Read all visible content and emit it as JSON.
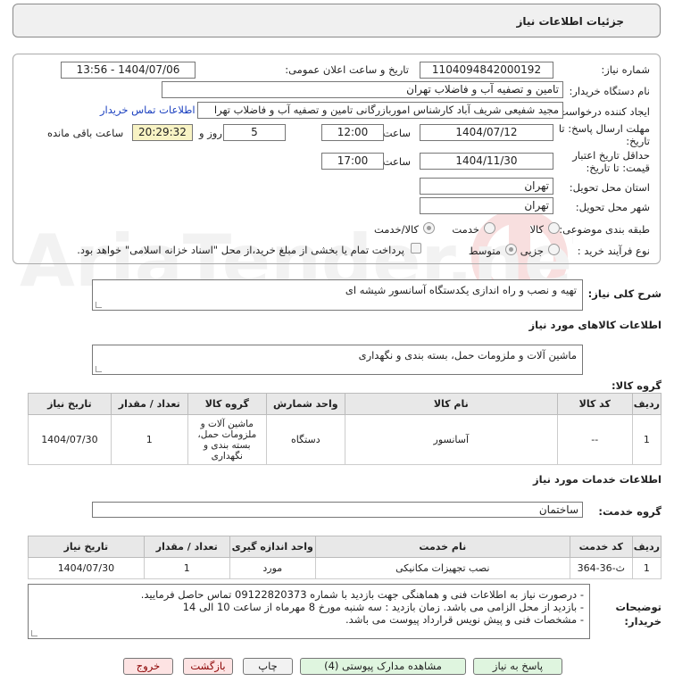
{
  "header": {
    "title": "جزئیات اطلاعات نیاز"
  },
  "watermark": {
    "text": "AriaTender.neT"
  },
  "form": {
    "need_number_label": "شماره نیاز:",
    "need_number": "1104094842000192",
    "announce_label": "تاریخ و ساعت اعلان عمومی:",
    "announce_value": "1404/07/06 - 13:56",
    "buyer_label": "نام دستگاه خریدار:",
    "buyer_value": "تامین و تصفیه آب و فاضلاب تهران",
    "requester_label": "ایجاد کننده درخواست:",
    "requester_value": "مجید شفیعی شریف آباد کارشناس اموربازرگانی تامین و تصفیه آب و فاضلاب تهرا",
    "contact_link": "اطلاعات تماس خریدار",
    "deadline_label_1": "مهلت ارسال پاسخ: تا",
    "deadline_label_2": "تاریخ:",
    "deadline_date": "1404/07/12",
    "time_label": "ساعت",
    "deadline_time": "12:00",
    "days_value": "5",
    "days_label": "روز و",
    "remaining_value": "20:29:32",
    "remaining_label": "ساعت باقی مانده",
    "validity_label_1": "حداقل تاریخ اعتبار",
    "validity_label_2": "قیمت: تا تاریخ:",
    "validity_date": "1404/11/30",
    "validity_time": "17:00",
    "province_label": "استان محل تحویل:",
    "province_value": "تهران",
    "city_label": "شهر محل تحویل:",
    "city_value": "تهران",
    "category_label": "طبقه بندی موضوعی:",
    "category_options": [
      "کالا",
      "خدمت",
      "کالا/خدمت"
    ],
    "process_label": "نوع فرآیند خرید :",
    "process_options": [
      "جزیی",
      "متوسط"
    ],
    "payment_note": "پرداخت تمام یا بخشی از مبلغ خرید،از محل \"اسناد خزانه اسلامی\" خواهد بود."
  },
  "summary": {
    "label": "شرح کلی نیاز:",
    "value": "تهیه و نصب و راه اندازی یکدستگاه آسانسور شیشه ای"
  },
  "goods": {
    "section_title": "اطلاعات کالاهای مورد نیاز",
    "group_label": "گروه کالا:",
    "group_value": "ماشین آلات و ملزومات حمل، بسته بندی و نگهداری",
    "columns": [
      "ردیف",
      "کد کالا",
      "نام کالا",
      "واحد شمارش",
      "گروه کالا",
      "تعداد / مقدار",
      "تاریخ نیاز"
    ],
    "rows": [
      {
        "row": "1",
        "code": "--",
        "name": "آسانسور",
        "unit": "دستگاه",
        "group": "ماشین آلات و ملزومات حمل، بسته بندی و نگهداری",
        "qty": "1",
        "date": "1404/07/30"
      }
    ]
  },
  "services": {
    "section_title": "اطلاعات خدمات مورد نیاز",
    "group_label": "گروه خدمت:",
    "group_value": "ساختمان",
    "columns": [
      "ردیف",
      "کد خدمت",
      "نام خدمت",
      "واحد اندازه گیری",
      "تعداد / مقدار",
      "تاریخ نیاز"
    ],
    "rows": [
      {
        "row": "1",
        "code": "ث-36-364",
        "name": "نصب تجهیزات مکانیکی",
        "unit": "مورد",
        "qty": "1",
        "date": "1404/07/30"
      }
    ]
  },
  "notes": {
    "label_1": "توضیحات",
    "label_2": "خریدار:",
    "lines": [
      "- درصورت نیاز به اطلاعات فنی و هماهنگی جهت بازدید با شماره 09122820373 تماس حاصل فرمایید.",
      "- بازدید از محل الزامی می باشد. زمان بازدید : سه شنبه مورخ 8 مهرماه از ساعت 10 الی 14",
      "- مشخصات فنی و پیش نویس قرارداد پیوست می باشد."
    ]
  },
  "buttons": {
    "reply": "پاسخ به نیاز",
    "attachments": "مشاهده مدارک پیوستی (4)",
    "print": "چاپ",
    "back": "بازگشت",
    "exit": "خروج"
  }
}
